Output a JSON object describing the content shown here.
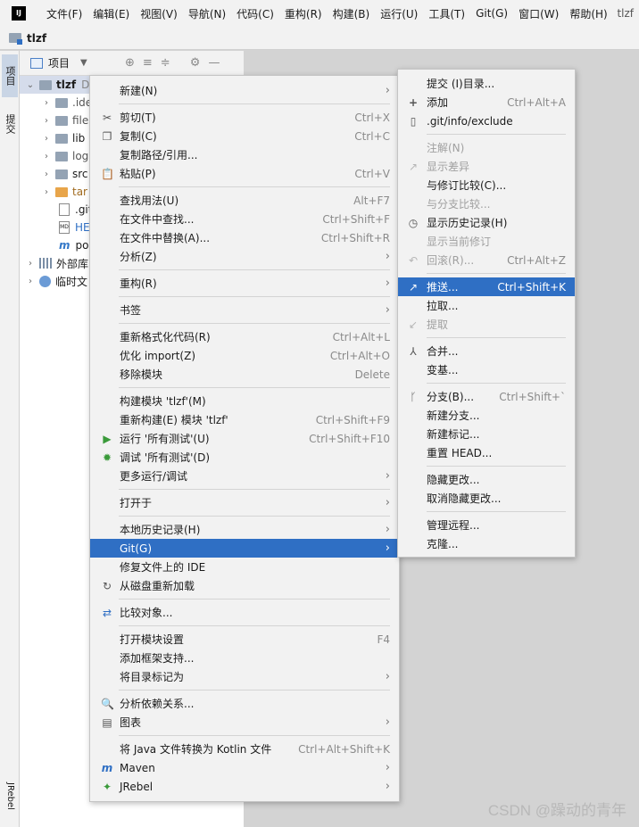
{
  "menubar": {
    "logo": "IJ",
    "items": [
      "文件(F)",
      "编辑(E)",
      "视图(V)",
      "导航(N)",
      "代码(C)",
      "重构(R)",
      "构建(B)",
      "运行(U)",
      "工具(T)",
      "Git(G)",
      "窗口(W)",
      "帮助(H)"
    ],
    "project": "tlzf"
  },
  "breadcrumb": {
    "project": "tlzf"
  },
  "left_strip": {
    "tab_project": "项目",
    "tab_commit": "提交",
    "tab_jrebel": "JRebel"
  },
  "project_panel": {
    "header": "项目",
    "root": {
      "name": "tlzf",
      "suffix": "D"
    },
    "rows": [
      ".ide",
      "file",
      "lib",
      "log",
      "src",
      "tar",
      ".git",
      "HE",
      "po",
      "外部库",
      "临时文"
    ]
  },
  "context_menu": {
    "new": "新建(N)",
    "cut": "剪切(T)",
    "cut_sc": "Ctrl+X",
    "copy": "复制(C)",
    "copy_sc": "Ctrl+C",
    "copy_path": "复制路径/引用...",
    "paste": "粘贴(P)",
    "paste_sc": "Ctrl+V",
    "find_usages": "查找用法(U)",
    "find_usages_sc": "Alt+F7",
    "find_in_files": "在文件中查找...",
    "find_in_files_sc": "Ctrl+Shift+F",
    "replace_in_files": "在文件中替换(A)...",
    "replace_in_files_sc": "Ctrl+Shift+R",
    "analyze": "分析(Z)",
    "refactor": "重构(R)",
    "bookmarks": "书签",
    "reformat": "重新格式化代码(R)",
    "reformat_sc": "Ctrl+Alt+L",
    "optimize_imports": "优化 import(Z)",
    "optimize_imports_sc": "Ctrl+Alt+O",
    "remove_module": "移除模块",
    "remove_module_sc": "Delete",
    "build_module": "构建模块 'tlzf'(M)",
    "rebuild_module": "重新构建(E) 模块 'tlzf'",
    "rebuild_module_sc": "Ctrl+Shift+F9",
    "run_tests": "运行 '所有测试'(U)",
    "run_tests_sc": "Ctrl+Shift+F10",
    "debug_tests": "调试 '所有测试'(D)",
    "more_run": "更多运行/调试",
    "open_in": "打开于",
    "local_history": "本地历史记录(H)",
    "git": "Git(G)",
    "fix_ide": "修复文件上的 IDE",
    "reload_disk": "从磁盘重新加载",
    "compare_with": "比较对象...",
    "module_settings": "打开模块设置",
    "module_settings_sc": "F4",
    "add_framework": "添加框架支持...",
    "mark_dir": "将目录标记为",
    "analyze_deps": "分析依赖关系...",
    "diagrams": "图表",
    "convert_kotlin": "将 Java 文件转换为 Kotlin 文件",
    "convert_kotlin_sc": "Ctrl+Alt+Shift+K",
    "maven": "Maven",
    "jrebel": "JRebel"
  },
  "git_menu": {
    "commit_dir": "提交 (I)目录...",
    "add": "添加",
    "add_sc": "Ctrl+Alt+A",
    "exclude": ".git/info/exclude",
    "annotate": "注解(N)",
    "show_diff": "显示差异",
    "compare_revision": "与修订比较(C)...",
    "compare_branch": "与分支比较...",
    "show_history": "显示历史记录(H)",
    "show_current_rev": "显示当前修订",
    "rollback": "回滚(R)...",
    "rollback_sc": "Ctrl+Alt+Z",
    "push": "推送...",
    "push_sc": "Ctrl+Shift+K",
    "pull": "拉取...",
    "fetch": "提取",
    "merge": "合并...",
    "rebase": "变基...",
    "branches": "分支(B)...",
    "branches_sc": "Ctrl+Shift+`",
    "new_branch": "新建分支...",
    "new_tag": "新建标记...",
    "reset_head": "重置 HEAD...",
    "stash": "隐藏更改...",
    "unstash": "取消隐藏更改...",
    "manage_remotes": "管理远程...",
    "clone": "克隆..."
  },
  "watermark": "CSDN @躁动的青年",
  "colors": {
    "highlight": "#2f6fc4",
    "menu_bg": "#f2f2f2",
    "disabled": "#a0a0a0"
  }
}
